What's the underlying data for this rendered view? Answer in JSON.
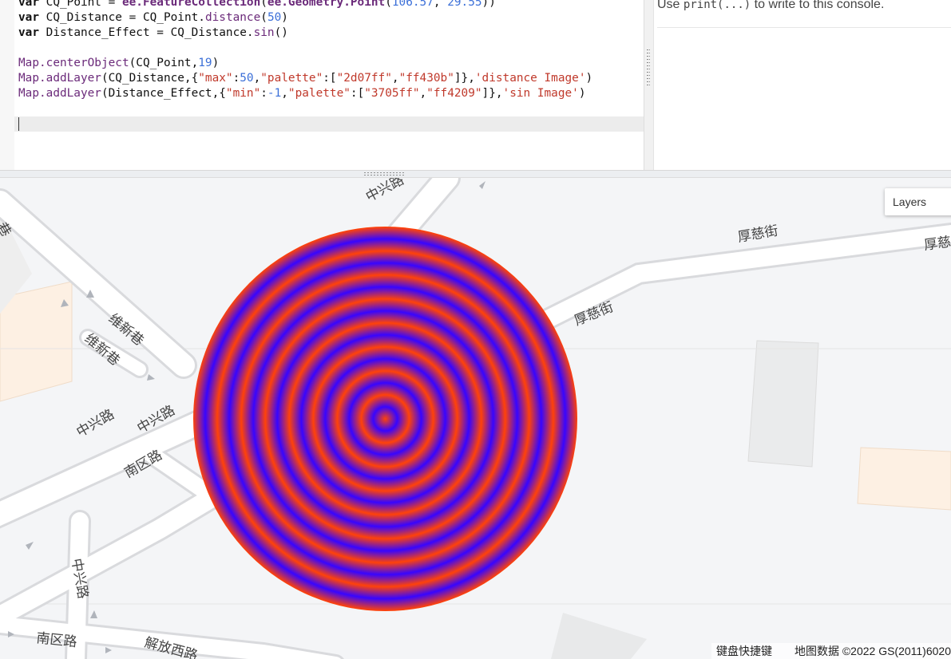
{
  "editor": {
    "lines": [
      [
        "var",
        " CQ_Point = ",
        "ee.FeatureCollection",
        "(",
        "ee.Geometry.Point",
        "(",
        "106.57",
        ", ",
        "29.55",
        "))"
      ],
      [
        "var",
        " CQ_Distance = ",
        "CQ_Point.",
        "distance",
        "(",
        "50",
        ")"
      ],
      [
        "var",
        " Distance_Effect = ",
        "CQ_Distance.",
        "sin",
        "()"
      ],
      [
        ""
      ],
      [
        "Map.",
        "centerObject",
        "(CQ_Point,",
        "19",
        ")"
      ],
      [
        "Map.",
        "addLayer",
        "(CQ_Distance,{",
        "\"max\"",
        ":",
        "50",
        ",",
        "\"palette\"",
        ":[",
        "\"2d07ff\"",
        ",",
        "\"ff430b\"",
        "]},",
        "'distance Image'",
        ")"
      ],
      [
        "Map.",
        "addLayer",
        "(Distance_Effect,{",
        "\"min\"",
        ":",
        "-1",
        ",",
        "\"palette\"",
        ":[",
        "\"3705ff\"",
        ",",
        "\"ff4209\"",
        "]},",
        "'sin Image'",
        ")"
      ]
    ],
    "line_classes": [
      [
        "kw",
        "",
        "ee",
        "",
        "ee",
        "",
        "num",
        "",
        "num",
        ""
      ],
      [
        "kw",
        "",
        "",
        "obj",
        "",
        "num",
        ""
      ],
      [
        "kw",
        "",
        "",
        "obj",
        ""
      ],
      [
        ""
      ],
      [
        "obj",
        "obj",
        "",
        "num",
        ""
      ],
      [
        "obj",
        "obj",
        "",
        "str",
        "",
        "num",
        "",
        "str",
        "",
        "str",
        "",
        "str",
        "",
        "str",
        ""
      ],
      [
        "obj",
        "obj",
        "",
        "str",
        "",
        "num",
        "",
        "str",
        "",
        "str",
        "",
        "str",
        "",
        "str",
        ""
      ]
    ]
  },
  "console": {
    "prefix": "Use ",
    "code": "print(...)",
    "suffix": " to write to this console."
  },
  "map": {
    "layers_label": "Layers",
    "keyboard_shortcuts": "键盘快捷键",
    "attribution": "地图数据 ©2022 GS(2011)6020",
    "road_labels": [
      "中兴路",
      "厚慈街",
      "厚慈",
      "厚慈街",
      "维新巷",
      "维新巷",
      "中兴路",
      "中兴路",
      "南区路",
      "中兴路",
      "南区路",
      "解放西路",
      "巷"
    ],
    "overlay": {
      "palette": [
        "#3705ff",
        "#ff4209"
      ],
      "ring_count": 8
    }
  }
}
